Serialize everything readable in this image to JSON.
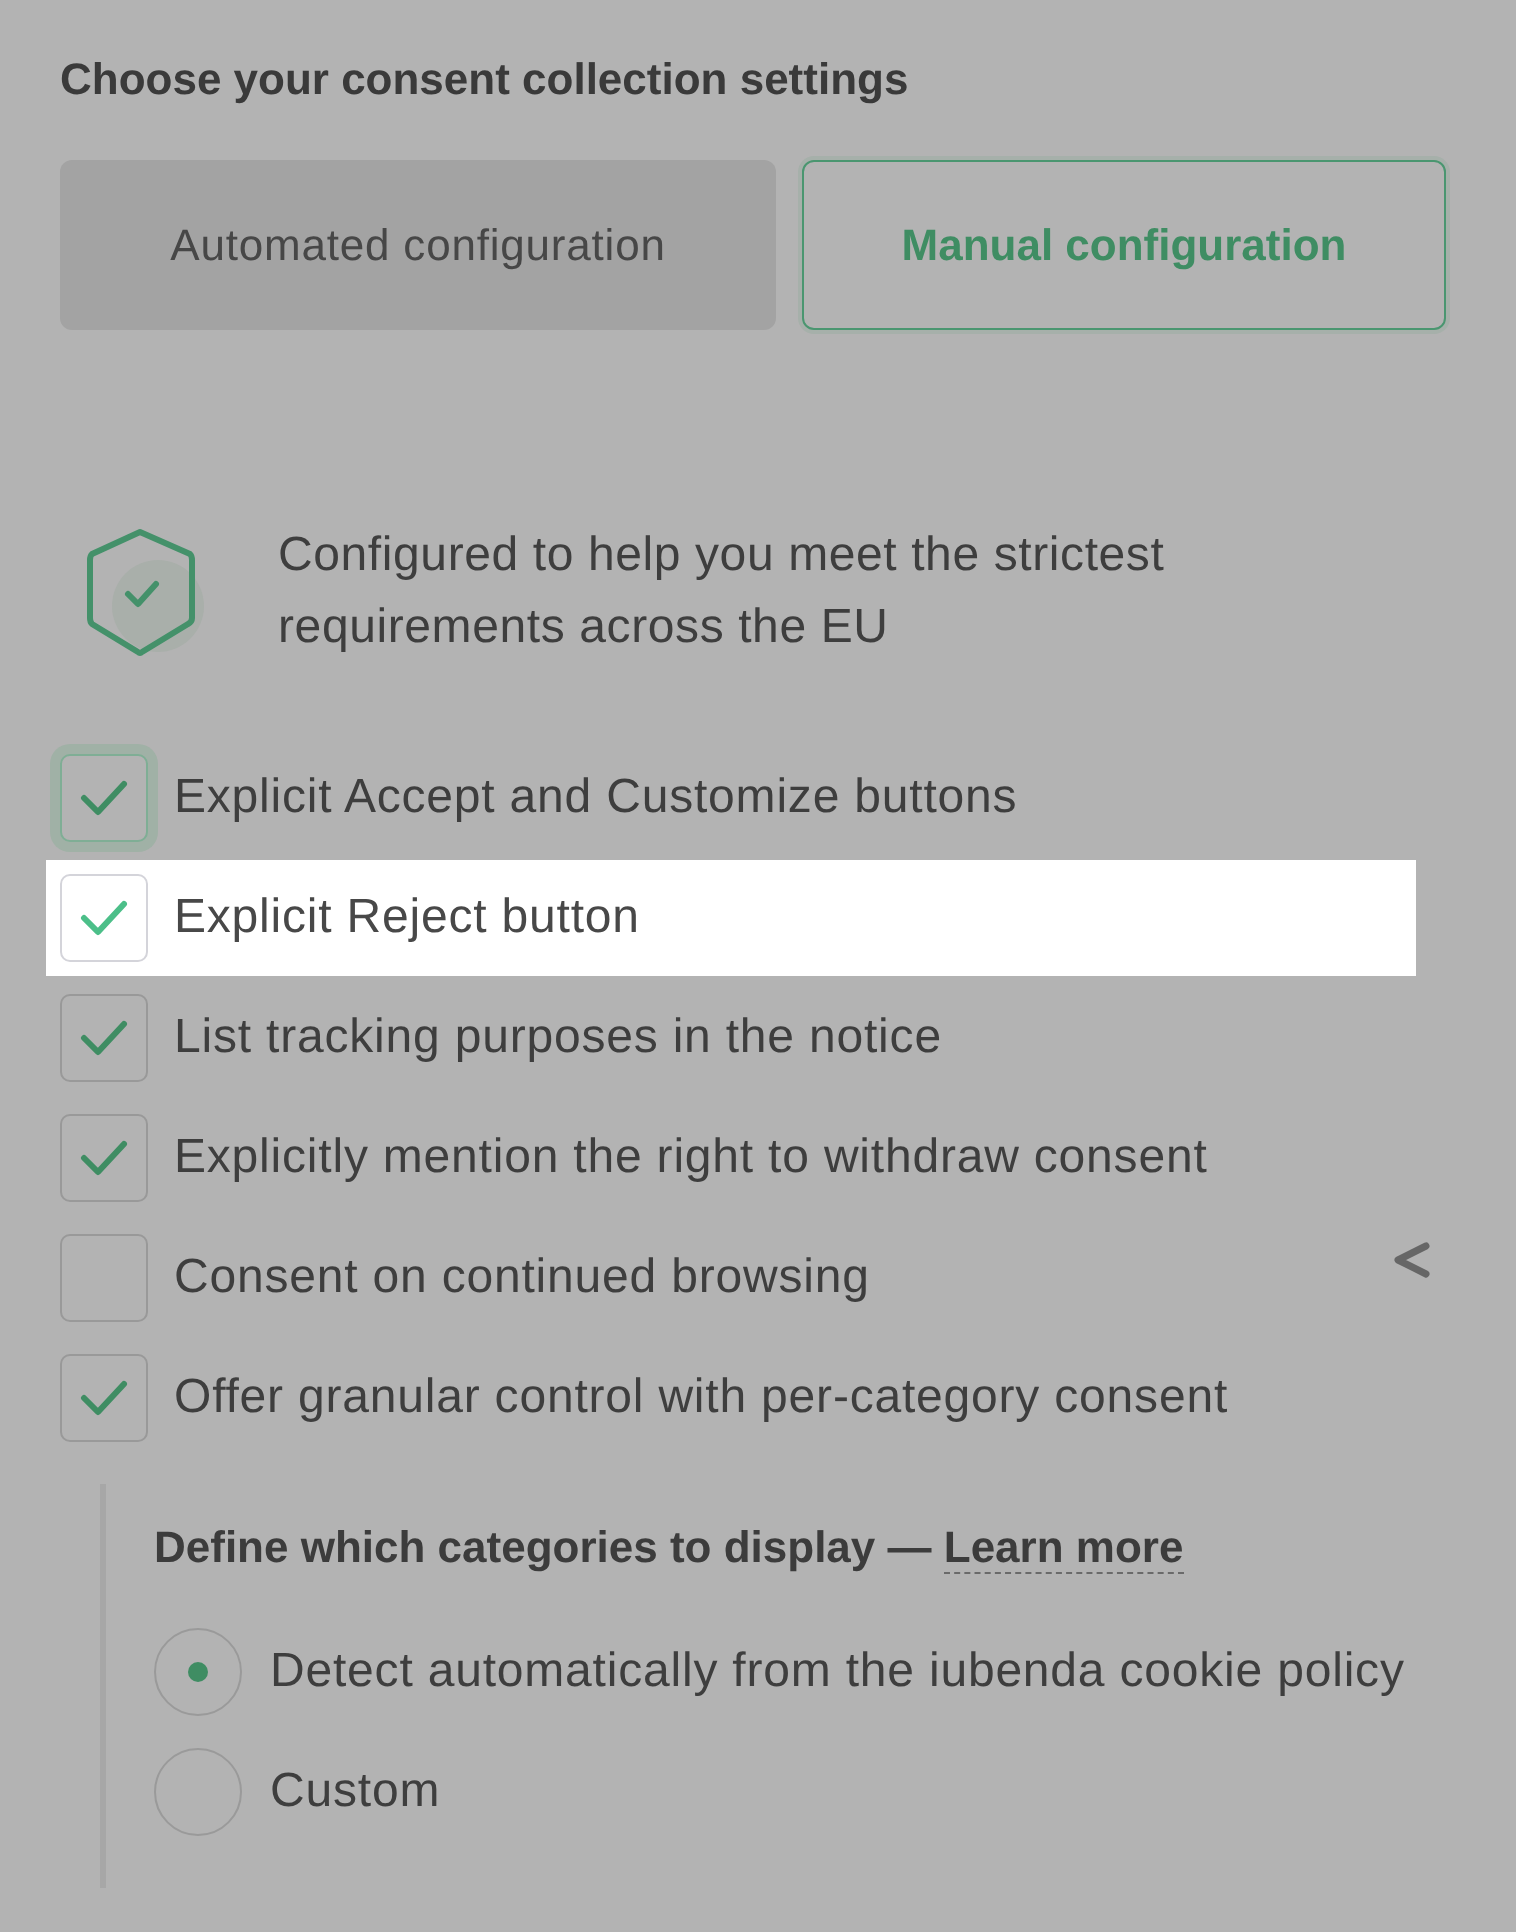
{
  "title": "Choose your consent collection settings",
  "config_tabs": [
    {
      "label": "Automated configuration",
      "selected": false
    },
    {
      "label": "Manual configuration",
      "selected": true
    }
  ],
  "notice": {
    "text": "Configured to help you meet the strictest requirements across the EU"
  },
  "options": [
    {
      "label": "Explicit Accept and Customize buttons",
      "checked": true,
      "focused": true,
      "highlighted": false
    },
    {
      "label": "Explicit Reject button",
      "checked": true,
      "focused": false,
      "highlighted": true
    },
    {
      "label": "List tracking purposes in the notice",
      "checked": true,
      "focused": false,
      "highlighted": false
    },
    {
      "label": "Explicitly mention the right to withdraw consent",
      "checked": true,
      "focused": false,
      "highlighted": false
    },
    {
      "label": "Consent on continued browsing",
      "checked": false,
      "focused": false,
      "highlighted": false
    },
    {
      "label": "Offer granular control with per-category consent",
      "checked": true,
      "focused": false,
      "highlighted": false
    }
  ],
  "categories": {
    "heading": "Define which categories to display —",
    "link": "Learn more",
    "choices": [
      {
        "label": "Detect automatically from the iubenda cookie policy",
        "selected": true
      },
      {
        "label": "Custom",
        "selected": false
      }
    ]
  }
}
